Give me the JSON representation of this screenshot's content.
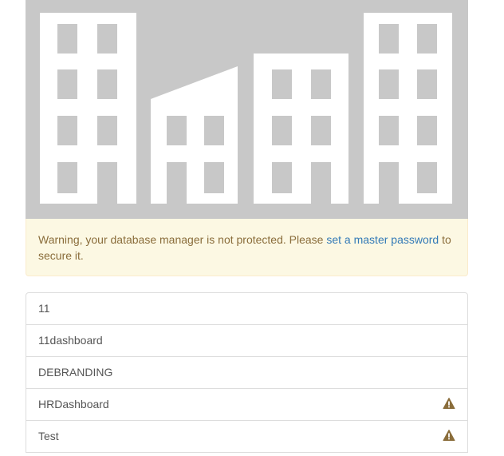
{
  "warning": {
    "text_before": "Warning, your database manager is not protected. Please ",
    "link": "set a master password",
    "text_after": " to secure it."
  },
  "databases": [
    {
      "name": "11",
      "warning_icon": ""
    },
    {
      "name": "11dashboard",
      "warning_icon": ""
    },
    {
      "name": "DEBRANDING",
      "warning_icon": ""
    },
    {
      "name": "HRDashboard",
      "warning_icon": "exclamation-triangle-icon"
    },
    {
      "name": "Test",
      "warning_icon": "exclamation-triangle-icon"
    }
  ],
  "colors": {
    "hero_bg": "#c8c8c8",
    "alert_bg": "#fcf8e3",
    "alert_text": "#8a6d3b",
    "link": "#337ab7",
    "warning_icon": "#8a6d3b"
  }
}
